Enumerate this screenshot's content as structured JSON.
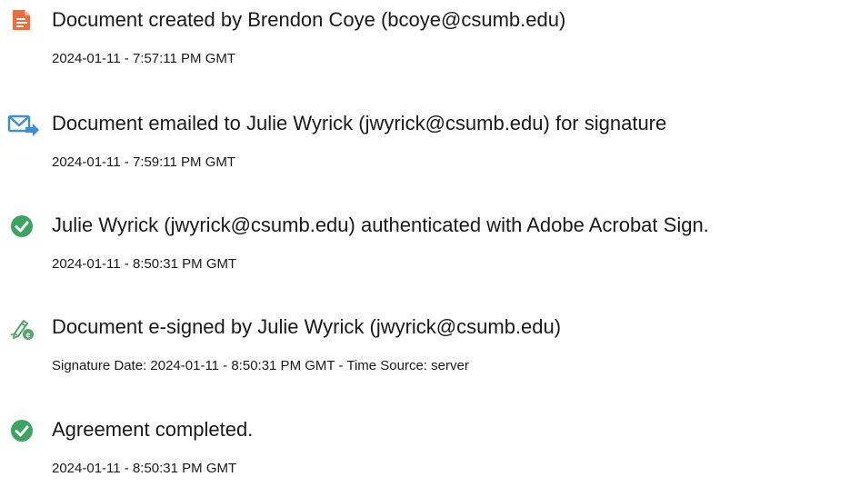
{
  "events": [
    {
      "icon": "document-created-icon",
      "title": "Document created by Brendon Coye (bcoye@csumb.edu)",
      "time": "2024-01-11 - 7:57:11 PM GMT"
    },
    {
      "icon": "document-emailed-icon",
      "title": "Document emailed to Julie Wyrick (jwyrick@csumb.edu) for signature",
      "time": "2024-01-11 - 7:59:11 PM GMT"
    },
    {
      "icon": "checkmark-circle-icon",
      "title": "Julie Wyrick (jwyrick@csumb.edu) authenticated with Adobe Acrobat Sign.",
      "time": "2024-01-11 - 8:50:31 PM GMT"
    },
    {
      "icon": "e-signed-pen-icon",
      "title": "Document e-signed by Julie Wyrick (jwyrick@csumb.edu)",
      "time": "Signature Date: 2024-01-11 - 8:50:31 PM GMT - Time Source: server"
    },
    {
      "icon": "checkmark-circle-icon",
      "title": "Agreement completed.",
      "time": "2024-01-11 - 8:50:31 PM GMT"
    }
  ],
  "colors": {
    "created_icon": "#f26b3a",
    "emailed_icon": "#3d8fd8",
    "check_icon": "#3aa55f",
    "pen_icon": "#55a56a"
  }
}
